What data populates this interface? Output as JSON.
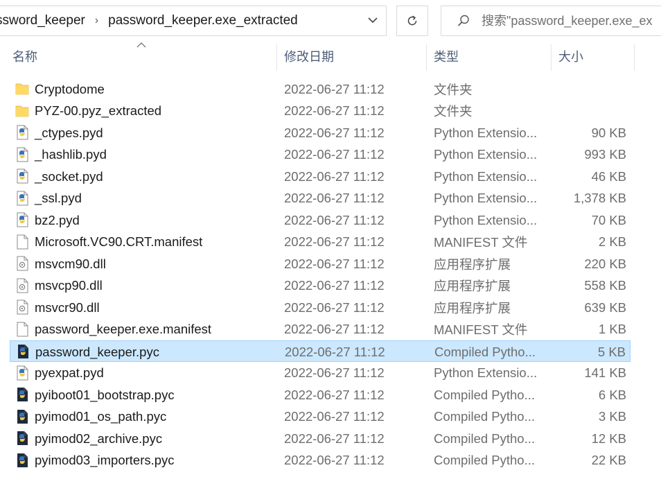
{
  "address": {
    "crumb1": "ssword_keeper",
    "crumb2": "password_keeper.exe_extracted"
  },
  "search": {
    "placeholder": "搜索\"password_keeper.exe_ex"
  },
  "columns": {
    "name": "名称",
    "date": "修改日期",
    "type": "类型",
    "size": "大小"
  },
  "files": [
    {
      "name": "Cryptodome",
      "date": "2022-06-27 11:12",
      "type": "文件夹",
      "size": "",
      "icon": "folder-icon"
    },
    {
      "name": "PYZ-00.pyz_extracted",
      "date": "2022-06-27 11:12",
      "type": "文件夹",
      "size": "",
      "icon": "folder-icon"
    },
    {
      "name": "_ctypes.pyd",
      "date": "2022-06-27 11:12",
      "type": "Python Extensio...",
      "size": "90 KB",
      "icon": "python-extension-icon"
    },
    {
      "name": "_hashlib.pyd",
      "date": "2022-06-27 11:12",
      "type": "Python Extensio...",
      "size": "993 KB",
      "icon": "python-extension-icon"
    },
    {
      "name": "_socket.pyd",
      "date": "2022-06-27 11:12",
      "type": "Python Extensio...",
      "size": "46 KB",
      "icon": "python-extension-icon"
    },
    {
      "name": "_ssl.pyd",
      "date": "2022-06-27 11:12",
      "type": "Python Extensio...",
      "size": "1,378 KB",
      "icon": "python-extension-icon"
    },
    {
      "name": "bz2.pyd",
      "date": "2022-06-27 11:12",
      "type": "Python Extensio...",
      "size": "70 KB",
      "icon": "python-extension-icon"
    },
    {
      "name": "Microsoft.VC90.CRT.manifest",
      "date": "2022-06-27 11:12",
      "type": "MANIFEST 文件",
      "size": "2 KB",
      "icon": "blank-file-icon"
    },
    {
      "name": "msvcm90.dll",
      "date": "2022-06-27 11:12",
      "type": "应用程序扩展",
      "size": "220 KB",
      "icon": "dll-file-icon"
    },
    {
      "name": "msvcp90.dll",
      "date": "2022-06-27 11:12",
      "type": "应用程序扩展",
      "size": "558 KB",
      "icon": "dll-file-icon"
    },
    {
      "name": "msvcr90.dll",
      "date": "2022-06-27 11:12",
      "type": "应用程序扩展",
      "size": "639 KB",
      "icon": "dll-file-icon"
    },
    {
      "name": "password_keeper.exe.manifest",
      "date": "2022-06-27 11:12",
      "type": "MANIFEST 文件",
      "size": "1 KB",
      "icon": "blank-file-icon"
    },
    {
      "name": "password_keeper.pyc",
      "date": "2022-06-27 11:12",
      "type": "Compiled Pytho...",
      "size": "5 KB",
      "icon": "compiled-python-icon",
      "selected": true
    },
    {
      "name": "pyexpat.pyd",
      "date": "2022-06-27 11:12",
      "type": "Python Extensio...",
      "size": "141 KB",
      "icon": "python-extension-icon"
    },
    {
      "name": "pyiboot01_bootstrap.pyc",
      "date": "2022-06-27 11:12",
      "type": "Compiled Pytho...",
      "size": "6 KB",
      "icon": "compiled-python-icon"
    },
    {
      "name": "pyimod01_os_path.pyc",
      "date": "2022-06-27 11:12",
      "type": "Compiled Pytho...",
      "size": "3 KB",
      "icon": "compiled-python-icon"
    },
    {
      "name": "pyimod02_archive.pyc",
      "date": "2022-06-27 11:12",
      "type": "Compiled Pytho...",
      "size": "12 KB",
      "icon": "compiled-python-icon"
    },
    {
      "name": "pyimod03_importers.pyc",
      "date": "2022-06-27 11:12",
      "type": "Compiled Pytho...",
      "size": "22 KB",
      "icon": "compiled-python-icon"
    }
  ],
  "colors": {
    "selection_bg": "#cce8ff",
    "selection_border": "#99d1ff",
    "header_text": "#4d5d78",
    "folder": "#f8d775"
  }
}
